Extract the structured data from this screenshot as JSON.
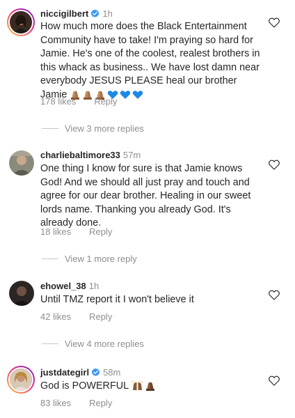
{
  "comments": [
    {
      "username": "niccigilbert",
      "verified": true,
      "time": "1h",
      "text": "How much more does the Black Entertainment Community have to take! I'm praying so hard for Jamie. He's one of the coolest, realest brothers in this whack as business.. We have lost damn near everybody JESUS PLEASE heal our brother Jamie",
      "likes": "178 likes",
      "reply": "Reply",
      "view_replies": "View 3 more replies",
      "avatar_icon": "profile-photo-avatar"
    },
    {
      "username": "charliebaltimore33",
      "verified": false,
      "time": "57m",
      "text": "One thing I know for sure is that Jamie knows God! And we should all just pray and touch and agree for our dear brother. Healing in our sweet lords name. Thanking you already God. It's already done.",
      "likes": "18 likes",
      "reply": "Reply",
      "view_replies": "View 1 more reply",
      "avatar_icon": "profile-photo-avatar"
    },
    {
      "username": "ehowel_38",
      "verified": false,
      "time": "1h",
      "text": "Until TMZ report it I won't believe it",
      "likes": "42 likes",
      "reply": "Reply",
      "view_replies": "View 4 more replies",
      "avatar_icon": "profile-photo-avatar"
    },
    {
      "username": "justdategirl",
      "verified": true,
      "time": "58m",
      "text": "God is POWERFUL",
      "likes": "83 likes",
      "reply": "Reply",
      "avatar_icon": "profile-photo-avatar"
    }
  ],
  "colors": {
    "verified": "#3897f0",
    "muted": "#8e8e8e",
    "text": "#262626",
    "blue_heart": "#1e88e5"
  },
  "icons": {
    "like": "heart-outline-icon",
    "verified": "verified-badge-icon",
    "pray": "folded-hands-emoji",
    "blue_heart": "blue-heart-emoji",
    "raise": "raising-hands-emoji"
  }
}
